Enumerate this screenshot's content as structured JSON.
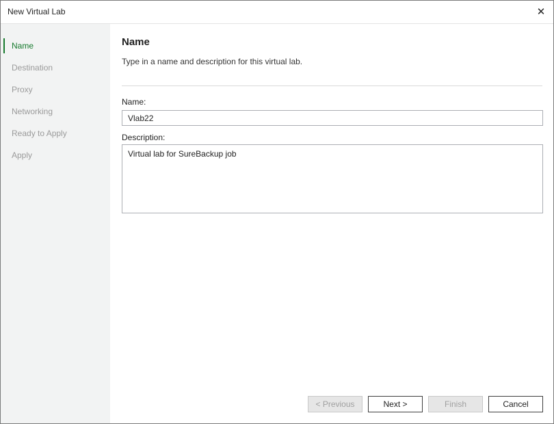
{
  "window": {
    "title": "New Virtual Lab"
  },
  "steps": [
    {
      "label": "Name",
      "active": true
    },
    {
      "label": "Destination",
      "active": false
    },
    {
      "label": "Proxy",
      "active": false
    },
    {
      "label": "Networking",
      "active": false
    },
    {
      "label": "Ready to Apply",
      "active": false
    },
    {
      "label": "Apply",
      "active": false
    }
  ],
  "page": {
    "heading": "Name",
    "subtitle": "Type in a name and description for this virtual lab.",
    "name_label": "Name:",
    "name_value": "Vlab22",
    "description_label": "Description:",
    "description_value": "Virtual lab for SureBackup job"
  },
  "buttons": {
    "previous": "< Previous",
    "next": "Next >",
    "finish": "Finish",
    "cancel": "Cancel"
  },
  "colors": {
    "accent": "#167a2d",
    "sidebar_bg": "#f2f3f3",
    "disabled_text": "#a0a0a0"
  },
  "icons": {
    "close": "close-icon"
  }
}
